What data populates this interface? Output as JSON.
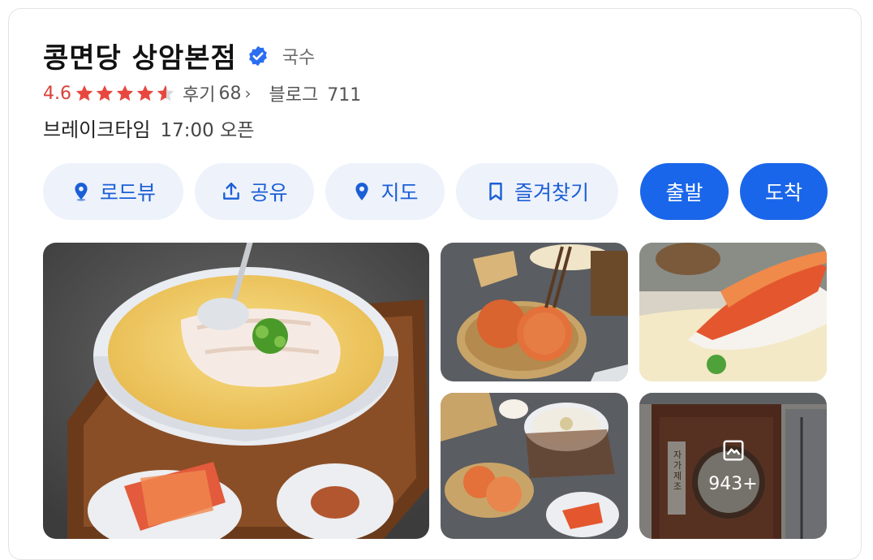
{
  "place": {
    "name": "콩면당 상암본점",
    "category": "국수",
    "rating": "4.6",
    "rating_value": 4.6,
    "rating_max": 5,
    "reviews_label": "후기",
    "reviews_count": "68",
    "reviews_chevron": "›",
    "blog_label": "블로그",
    "blog_count": "711",
    "hours_status": "브레이크타임",
    "hours_time": "17:00 오픈"
  },
  "actions": {
    "roadview": "로드뷰",
    "share": "공유",
    "map": "지도",
    "bookmark": "즐겨찾기",
    "depart": "출발",
    "arrive": "도착"
  },
  "photos": {
    "more_count": "943+",
    "storefront_sign": "자가제조"
  },
  "colors": {
    "accent": "#1a66ea",
    "rating": "#d9413a",
    "light_button_bg": "#eef2fb"
  },
  "icons": [
    "verified-badge-icon",
    "star-icon",
    "pin-icon",
    "share-icon",
    "location-icon",
    "bookmark-icon",
    "gallery-icon"
  ]
}
